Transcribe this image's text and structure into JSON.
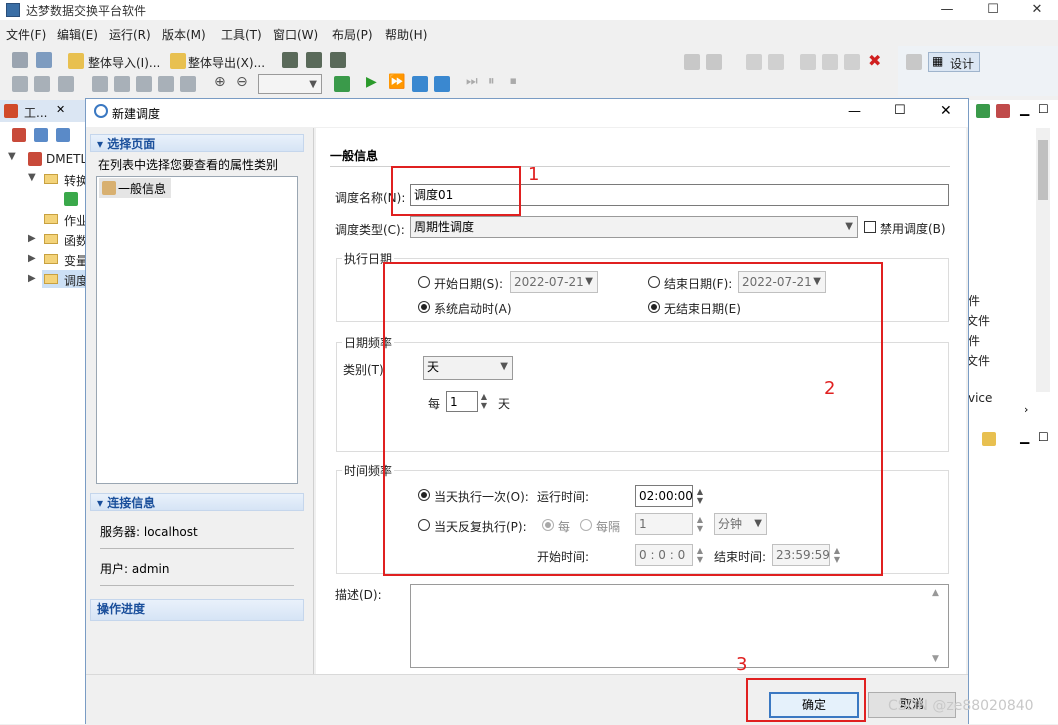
{
  "app": {
    "title": "达梦数据交换平台软件",
    "window_controls": [
      "—",
      "☐",
      "✕"
    ]
  },
  "menu": [
    "文件(F)",
    "编辑(E)",
    "运行(R)",
    "版本(M)",
    "工具(T)",
    "窗口(W)",
    "布局(P)",
    "帮助(H)"
  ],
  "toolbar": {
    "import_label": "整体导入(I)...",
    "export_label": "整体导出(X)...",
    "design_label": "设计"
  },
  "left_panel": {
    "tab_label": "工...",
    "tree": [
      {
        "label": "DMETL",
        "icon": "project-icon"
      },
      {
        "label": "转换",
        "icon": "folder-icon"
      },
      {
        "label": "作业",
        "icon": "folder-icon"
      },
      {
        "label": "函数",
        "icon": "folder-icon"
      },
      {
        "label": "变量",
        "icon": "folder-icon"
      },
      {
        "label": "调度",
        "icon": "folder-icon"
      }
    ]
  },
  "right_panel": {
    "items": [
      "件",
      "文件",
      "件",
      "文件",
      "vice"
    ]
  },
  "dialog": {
    "title": "新建调度",
    "nav": {
      "select_page_header": "选择页面",
      "select_page_hint": "在列表中选择您要查看的属性类别",
      "pages": [
        "一般信息"
      ],
      "connection_header": "连接信息",
      "server_label": "服务器: localhost",
      "user_label": "用户: admin",
      "progress_header": "操作进度"
    },
    "content": {
      "section_title": "一般信息",
      "name_label": "调度名称(N):",
      "name_value": "调度01",
      "type_label": "调度类型(C):",
      "type_value": "周期性调度",
      "disable_label": "禁用调度(B)",
      "exec_date": {
        "title": "执行日期",
        "start_date_label": "开始日期(S):",
        "start_date_value": "2022-07-21",
        "end_date_label": "结束日期(F):",
        "end_date_value": "2022-07-21",
        "system_start_label": "系统启动时(A)",
        "no_end_label": "无结束日期(E)"
      },
      "date_freq": {
        "title": "日期频率",
        "category_label": "类别(T)",
        "category_value": "天",
        "every_label": "每",
        "every_value": "1",
        "unit_label": "天"
      },
      "time_freq": {
        "title": "时间频率",
        "once_label": "当天执行一次(O):",
        "run_time_label": "运行时间:",
        "run_time_value": "02:00:00",
        "repeat_label": "当天反复执行(P):",
        "every_label": "每",
        "every_interval_label": "每隔",
        "interval_value": "1",
        "interval_unit": "分钟",
        "start_time_label": "开始时间:",
        "start_time_value": "0 : 0 : 0",
        "end_time_label": "结束时间:",
        "end_time_value": "23:59:59"
      },
      "desc_label": "描述(D):"
    },
    "buttons": {
      "ok": "确定",
      "cancel": "取消"
    }
  },
  "annotations": [
    "1",
    "2",
    "3"
  ],
  "watermark": "CSDN @ze88020840",
  "colors": {
    "annotation_red": "#e02020",
    "nav_header_blue": "#1a4f9b",
    "primary_border": "#3a78c2"
  }
}
